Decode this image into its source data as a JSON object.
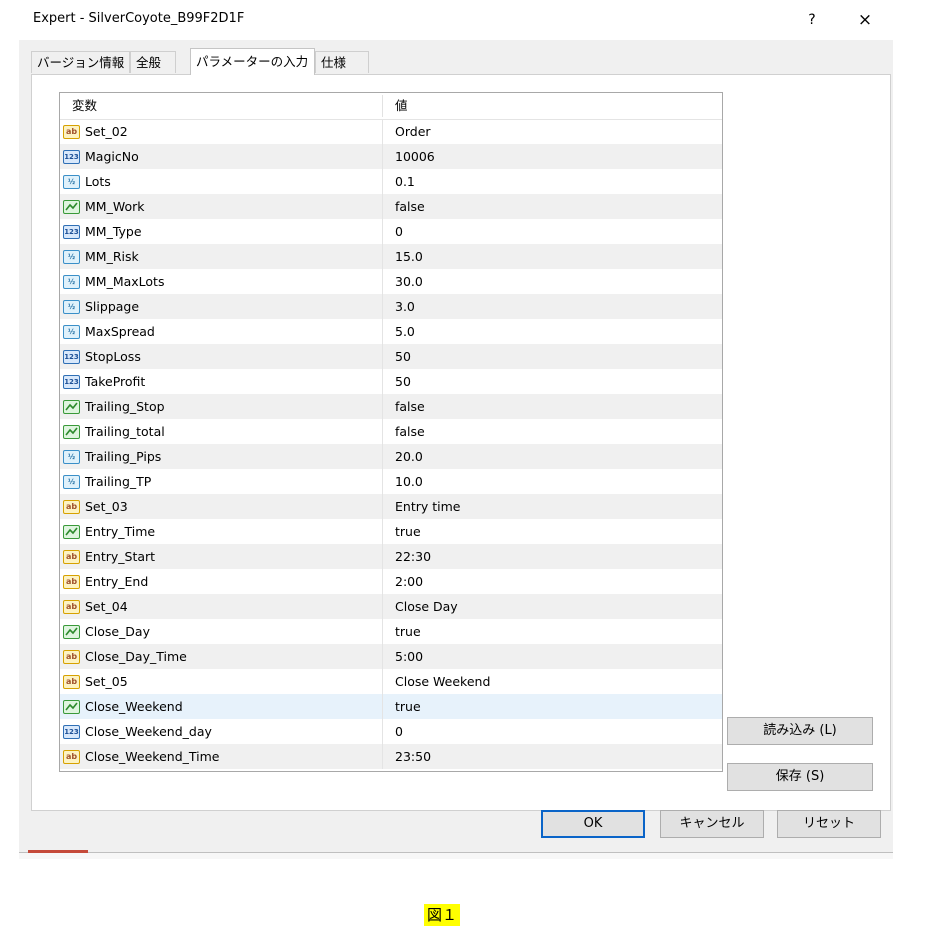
{
  "window": {
    "title": "Expert - SilverCoyote_B99F2D1F",
    "help_label": "?",
    "close_label": "×"
  },
  "tabs": [
    {
      "label": "バージョン情報"
    },
    {
      "label": "全般"
    },
    {
      "label": "パラメーターの入力"
    },
    {
      "label": "仕様"
    }
  ],
  "grid": {
    "headers": {
      "name": "変数",
      "value": "値"
    },
    "rows": [
      {
        "icon": "ab",
        "name": "Set_02",
        "value": "Order"
      },
      {
        "icon": "123",
        "name": "MagicNo",
        "value": "10006"
      },
      {
        "icon": "1/2",
        "name": "Lots",
        "value": "0.1"
      },
      {
        "icon": "bool",
        "name": "MM_Work",
        "value": "false"
      },
      {
        "icon": "123",
        "name": "MM_Type",
        "value": "0"
      },
      {
        "icon": "1/2",
        "name": "MM_Risk",
        "value": "15.0"
      },
      {
        "icon": "1/2",
        "name": "MM_MaxLots",
        "value": "30.0"
      },
      {
        "icon": "1/2",
        "name": "Slippage",
        "value": "3.0"
      },
      {
        "icon": "1/2",
        "name": "MaxSpread",
        "value": "5.0"
      },
      {
        "icon": "123",
        "name": "StopLoss",
        "value": "50"
      },
      {
        "icon": "123",
        "name": "TakeProfit",
        "value": "50"
      },
      {
        "icon": "bool",
        "name": "Trailing_Stop",
        "value": "false"
      },
      {
        "icon": "bool",
        "name": "Trailing_total",
        "value": "false"
      },
      {
        "icon": "1/2",
        "name": "Trailing_Pips",
        "value": "20.0"
      },
      {
        "icon": "1/2",
        "name": "Trailing_TP",
        "value": "10.0"
      },
      {
        "icon": "ab",
        "name": "Set_03",
        "value": "Entry time"
      },
      {
        "icon": "bool",
        "name": "Entry_Time",
        "value": "true"
      },
      {
        "icon": "ab",
        "name": "Entry_Start",
        "value": "22:30"
      },
      {
        "icon": "ab",
        "name": "Entry_End",
        "value": "2:00"
      },
      {
        "icon": "ab",
        "name": "Set_04",
        "value": "Close Day"
      },
      {
        "icon": "bool",
        "name": "Close_Day",
        "value": "true"
      },
      {
        "icon": "ab",
        "name": "Close_Day_Time",
        "value": "5:00"
      },
      {
        "icon": "ab",
        "name": "Set_05",
        "value": "Close Weekend"
      },
      {
        "icon": "bool",
        "name": "Close_Weekend",
        "value": "true",
        "selected": true
      },
      {
        "icon": "123",
        "name": "Close_Weekend_day",
        "value": "0"
      },
      {
        "icon": "ab",
        "name": "Close_Weekend_Time",
        "value": "23:50"
      }
    ]
  },
  "side_buttons": {
    "load": "読み込み (L)",
    "save": "保存 (S)"
  },
  "footer_buttons": {
    "ok": "OK",
    "cancel": "キャンセル",
    "reset": "リセット"
  },
  "caption": "図１",
  "colors": {
    "selected_row": "#e7f2fb",
    "alt_row": "#f0f0f0",
    "ok_border": "#0a64c8",
    "caption_bg": "#ffff00"
  }
}
